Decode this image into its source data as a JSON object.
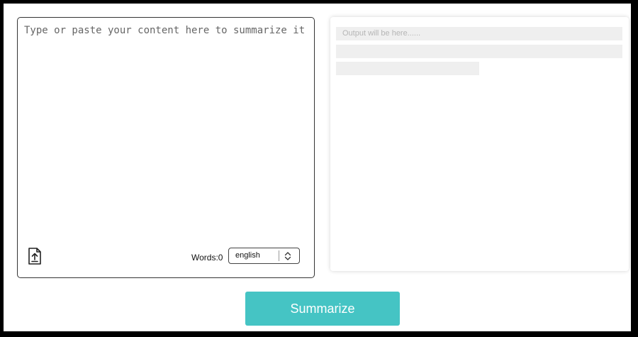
{
  "input": {
    "value": "",
    "placeholder": "Type or paste your content here to summarize it"
  },
  "upload": {
    "icon": "file-upload-icon"
  },
  "word_count": {
    "label": "Words:0"
  },
  "language_select": {
    "selected": "english",
    "icon": "up-down-chevron-icon"
  },
  "output": {
    "placeholder": "Output will be here......"
  },
  "actions": {
    "summarize_label": "Summarize"
  },
  "colors": {
    "accent": "#45c4c4",
    "skeleton": "#efefef",
    "page_border": "#000000"
  }
}
